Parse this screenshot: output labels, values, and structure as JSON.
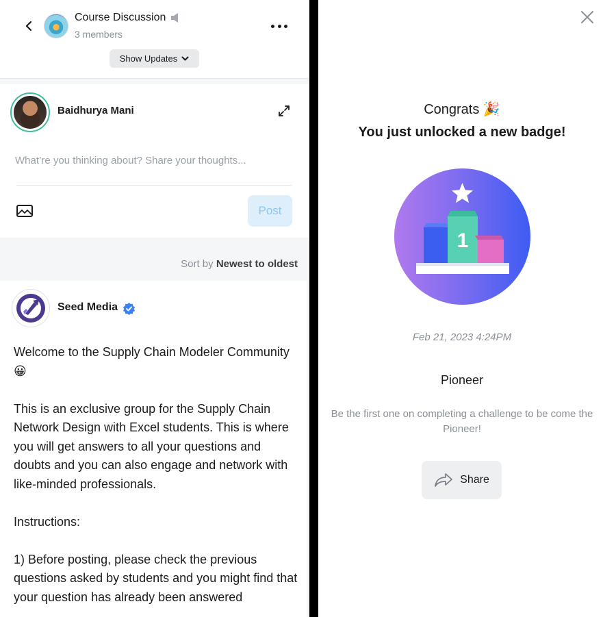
{
  "discussion": {
    "title": "Course Discussion",
    "members": "3 members",
    "show_updates": "Show Updates"
  },
  "composer": {
    "user_name": "Baidhurya Mani",
    "placeholder": "What’re you thinking about? Share your thoughts...",
    "post_label": "Post"
  },
  "sort": {
    "prefix": "Sort by",
    "value": "Newest to oldest"
  },
  "post": {
    "author": "Seed Media",
    "paragraphs": [
      "Welcome to the Supply Chain Modeler Community 😀",
      "This is an exclusive group for the Supply Chain Network Design with Excel students. This is where you will get answers to all your questions and doubts and you can also engage and network with like-minded professionals.",
      "Instructions:",
      "1) Before posting, please check the previous questions asked by students and you might find that your question has already been answered"
    ]
  },
  "badge_modal": {
    "congrats": "Congrats 🎉",
    "headline": "You just unlocked a new badge!",
    "badge_number": "1",
    "date": "Feb 21, 2023 4:24PM",
    "badge_name": "Pioneer",
    "description": "Be the first one on completing a challenge to be come the Pioneer!",
    "share_label": "Share"
  },
  "colors": {
    "accent_teal": "#3dbd9a",
    "post_button_bg": "#deeffb",
    "post_button_text": "#8fc6ec",
    "verified_blue": "#3b82f6",
    "badge_gradient_start": "#b079ee",
    "badge_gradient_end": "#3e5cf2"
  },
  "icons": {
    "back": "chevron-left-icon",
    "mute": "speaker-icon",
    "more": "more-horizontal-icon",
    "dropdown": "chevron-down-icon",
    "expand": "expand-icon",
    "image": "image-icon",
    "verified": "verified-badge-icon",
    "close": "close-icon",
    "share": "share-arrow-icon"
  }
}
